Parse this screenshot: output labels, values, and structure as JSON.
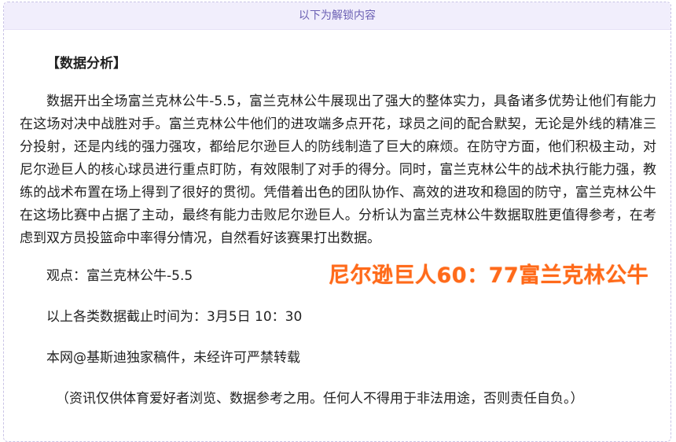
{
  "unlock_bar": {
    "label": "以下为解锁内容"
  },
  "article": {
    "section_title": "【数据分析】",
    "paragraph": "数据开出全场富兰克林公牛-5.5，富兰克林公牛展现出了强大的整体实力，具备诸多优势让他们有能力在这场对决中战胜对手。富兰克林公牛他们的进攻端多点开花，球员之间的配合默契，无论是外线的精准三分投射，还是内线的强力强攻，都给尼尔逊巨人的防线制造了巨大的麻烦。在防守方面，他们积极主动，对尼尔逊巨人的核心球员进行重点盯防，有效限制了对手的得分。同时，富兰克林公牛的战术执行能力强，教练的战术布置在场上得到了很好的贯彻。凭借着出色的团队协作、高效的进攻和稳固的防守，富兰克林公牛在这场比赛中占据了主动，最终有能力击败尼尔逊巨人。分析认为富兰克林公牛数据取胜更值得参考，在考虑到双方员投篮命中率得分情况，自然看好该赛果打出数据。",
    "viewpoint": "观点：富兰克林公牛-5.5",
    "data_time": "以上各类数据截止时间为：3月5日 10：30",
    "copyright": "本网@基斯迪独家稿件，未经许可严禁转载",
    "disclaimer": "（资讯仅供体育爱好者浏览、数据参考之用。任何人不得用于非法用途，否则责任自负。）"
  },
  "score_overlay": {
    "text": "尼尔逊巨人60：77富兰克林公牛",
    "color": "#ff6a1a"
  }
}
